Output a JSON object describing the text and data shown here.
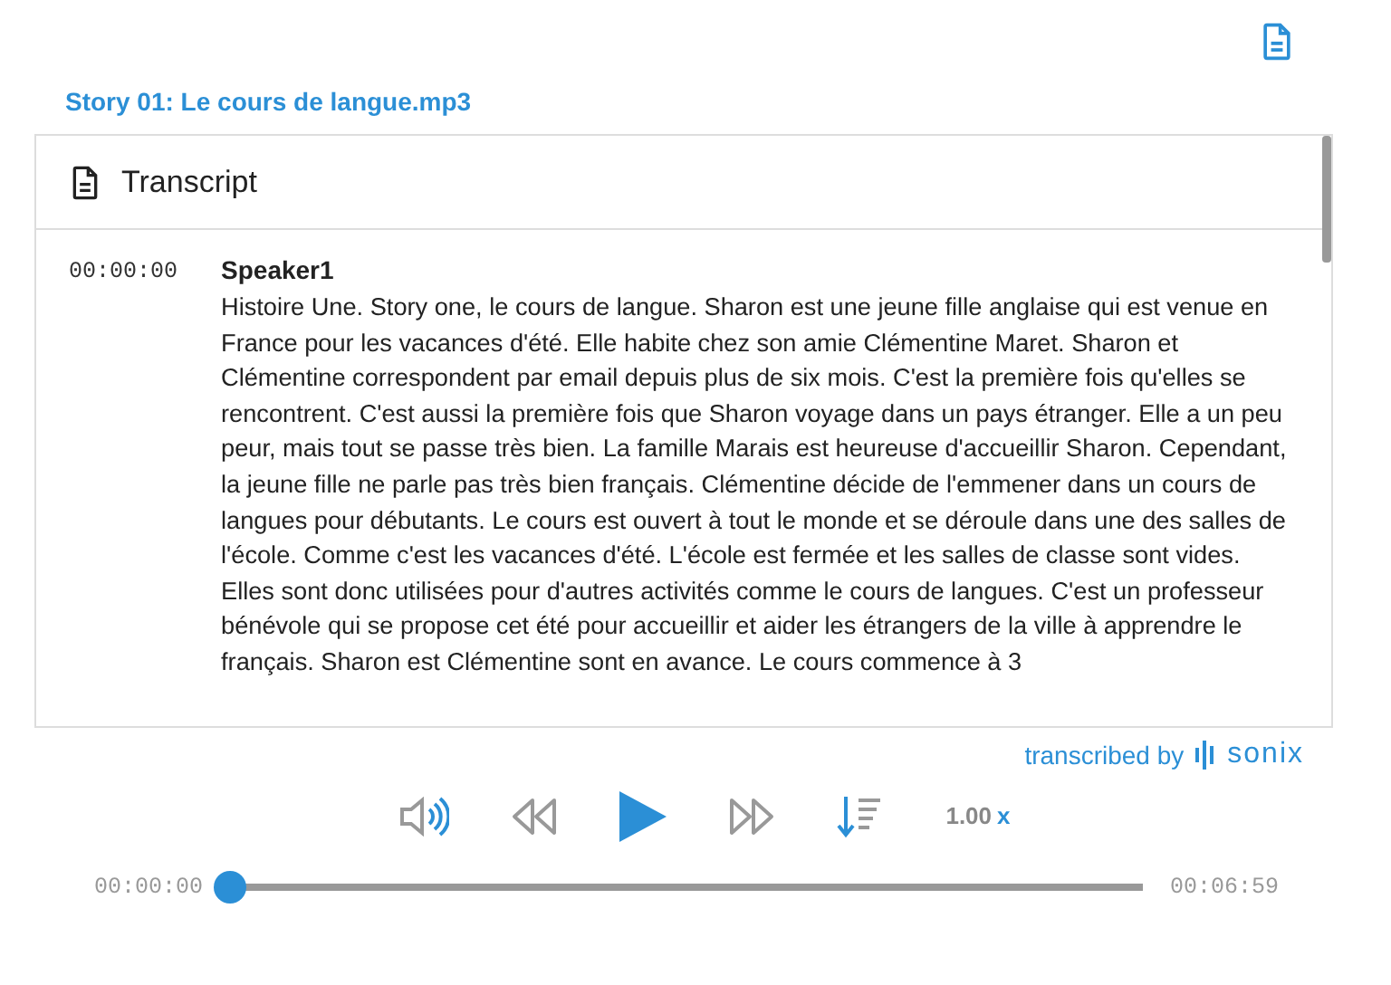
{
  "file_title": "Story 01: Le cours de langue.mp3",
  "transcript": {
    "title": "Transcript",
    "segments": [
      {
        "time": "00:00:00",
        "speaker": "Speaker1",
        "text": "Histoire Une. Story one, le cours de langue. Sharon est une jeune fille anglaise qui est venue en France pour les vacances d'été. Elle habite chez son amie Clémentine Maret. Sharon et Clémentine correspondent par email depuis plus de six mois. C'est la première fois qu'elles se rencontrent. C'est aussi la première fois que Sharon voyage dans un pays étranger. Elle a un peu peur, mais tout se passe très bien. La famille Marais est heureuse d'accueillir Sharon. Cependant, la jeune fille ne parle pas très bien français. Clémentine décide de l'emmener dans un cours de langues pour débutants. Le cours est ouvert à tout le monde et se déroule dans une des salles de l'école. Comme c'est les vacances d'été. L'école est fermée et les salles de classe sont vides. Elles sont donc utilisées pour d'autres activités comme le cours de langues. C'est un professeur bénévole qui se propose cet été pour accueillir et aider les étrangers de la ville à apprendre le français. Sharon est Clémentine sont en avance. Le cours commence à 3"
      }
    ]
  },
  "credit": {
    "label": "transcribed by",
    "brand": "sonix"
  },
  "player": {
    "speed": "1.00",
    "speed_unit": "x",
    "current_time": "00:00:00",
    "duration": "00:06:59",
    "level": 0
  }
}
